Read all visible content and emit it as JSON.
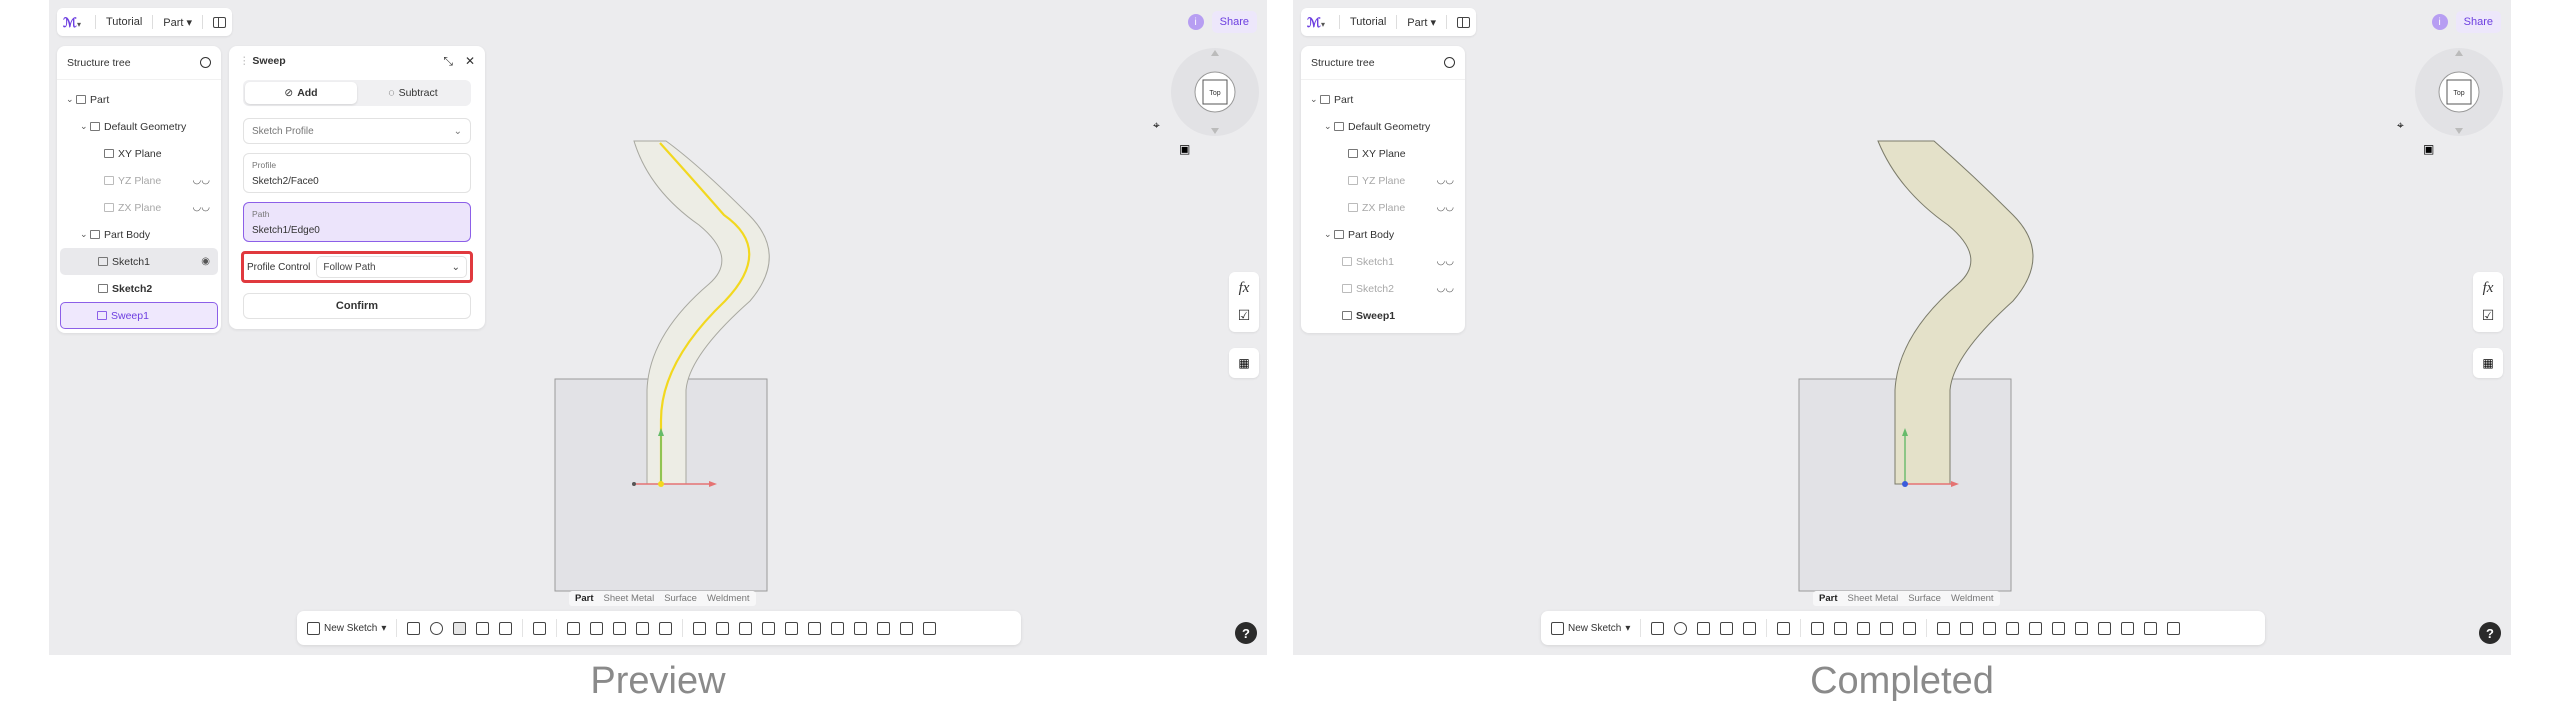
{
  "captions": {
    "left": "Preview",
    "right": "Completed"
  },
  "topbar": {
    "tutorial": "Tutorial",
    "part": "Part",
    "share": "Share"
  },
  "tree": {
    "title": "Structure tree",
    "items": {
      "part": "Part",
      "default_geometry": "Default Geometry",
      "xy_plane": "XY Plane",
      "yz_plane": "YZ Plane",
      "zx_plane": "ZX Plane",
      "part_body": "Part Body",
      "sketch1": "Sketch1",
      "sketch2": "Sketch2",
      "sweep1": "Sweep1"
    }
  },
  "sweep_panel": {
    "title": "Sweep",
    "add": "Add",
    "subtract": "Subtract",
    "sketch_profile": "Sketch Profile",
    "profile_caption": "Profile",
    "profile_value": "Sketch2/Face0",
    "path_caption": "Path",
    "path_value": "Sketch1/Edge0",
    "profile_control_label": "Profile Control",
    "profile_control_value": "Follow Path",
    "confirm": "Confirm"
  },
  "viewcube": {
    "face": "Top"
  },
  "right_tools": {
    "fx": "fx"
  },
  "mode_tabs": [
    "Part",
    "Sheet Metal",
    "Surface",
    "Weldment"
  ],
  "bottom_toolbar": {
    "new_sketch": "New Sketch"
  },
  "help": "?",
  "colors": {
    "accent": "#8c5fe8",
    "highlight_border": "#e0393e",
    "path_yellow": "#f2d81f",
    "solid_fill": "#e4e1c9"
  }
}
